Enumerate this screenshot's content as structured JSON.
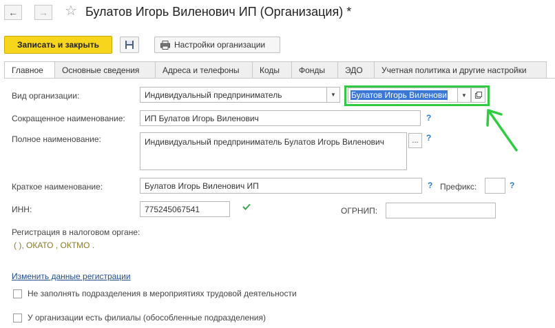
{
  "window": {
    "title": "Булатов Игорь Виленович ИП (Организация)",
    "modified_mark": "*"
  },
  "nav": {
    "back_icon": "←",
    "forward_icon": "→",
    "star_icon": "☆"
  },
  "toolbar": {
    "save_close_label": "Записать и закрыть",
    "org_settings_label": "Настройки организации"
  },
  "tabs": [
    {
      "label": "Главное",
      "active": true
    },
    {
      "label": "Основные сведения"
    },
    {
      "label": "Адреса и телефоны"
    },
    {
      "label": "Коды"
    },
    {
      "label": "Фонды"
    },
    {
      "label": "ЭДО"
    },
    {
      "label": "Учетная политика и другие настройки"
    }
  ],
  "form": {
    "org_type": {
      "label": "Вид организации:",
      "value": "Индивидуальный предприниматель"
    },
    "individual": {
      "value": "Булатов Игорь Виленови"
    },
    "short_name": {
      "label": "Сокращенное наименование:",
      "value": "ИП Булатов Игорь Виленович",
      "help": "?"
    },
    "full_name": {
      "label": "Полное наименование:",
      "value": "Индивидуальный предприниматель Булатов Игорь Виленович",
      "more": "...",
      "help": "?"
    },
    "brief_name": {
      "label": "Краткое наименование:",
      "value": "Булатов Игорь Виленович ИП",
      "help": "?"
    },
    "prefix": {
      "label": "Префикс:",
      "value": "",
      "help": "?"
    },
    "inn": {
      "label": "ИНН:",
      "value": "775245067541"
    },
    "ogrnip": {
      "label": "ОГРНИП:",
      "value": ""
    },
    "tax_registration": {
      "label": "Регистрация в налоговом органе:",
      "value": "(   ), ОКАТО , ОКТМО ."
    },
    "change_registration_link": "Изменить данные регистрации",
    "checkbox_no_subdivisions": "Не заполнять подразделения в мероприятиях трудовой деятельности",
    "checkbox_branches": "У организации есть филиалы (обособленные подразделения)"
  },
  "colors": {
    "accent_yellow": "#f7d51d",
    "highlight_green": "#2ecc40",
    "selection_blue": "#3b78d6",
    "help_blue": "#2b7bd0"
  }
}
